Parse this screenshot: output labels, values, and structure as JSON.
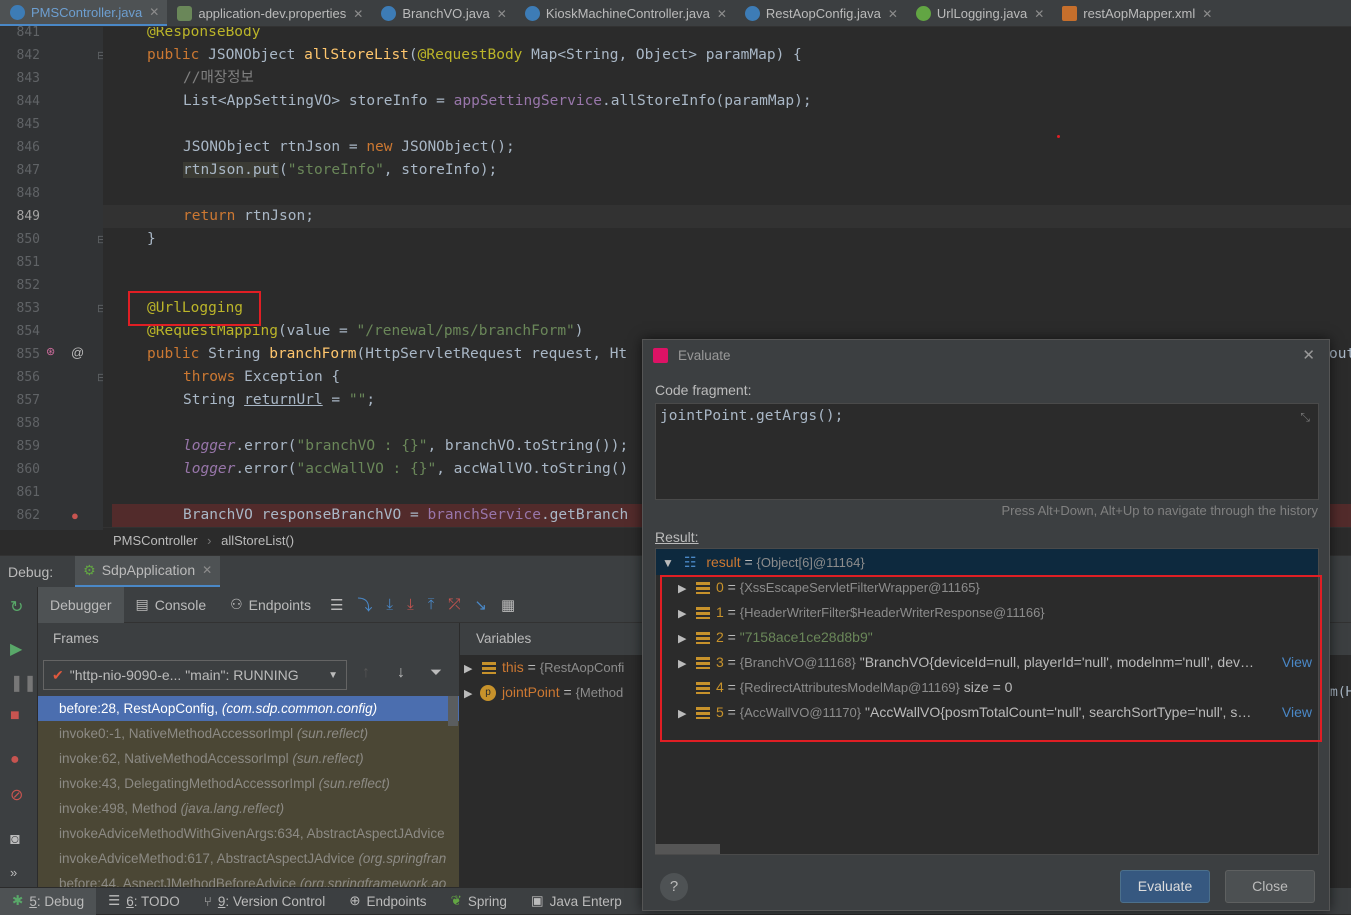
{
  "tabs": [
    {
      "label": "PMSController.java",
      "icon": "class-icon",
      "active": true
    },
    {
      "label": "application-dev.properties",
      "icon": "properties-icon",
      "active": false
    },
    {
      "label": "BranchVO.java",
      "icon": "class-icon",
      "active": false
    },
    {
      "label": "KioskMachineController.java",
      "icon": "class-icon",
      "active": false
    },
    {
      "label": "RestAopConfig.java",
      "icon": "class-icon",
      "active": false
    },
    {
      "label": "UrlLogging.java",
      "icon": "annotation-icon",
      "active": false
    },
    {
      "label": "restAopMapper.xml",
      "icon": "xml-icon",
      "active": false
    }
  ],
  "editor": {
    "line_numbers": [
      "841",
      "842",
      "843",
      "844",
      "845",
      "846",
      "847",
      "848",
      "849",
      "850",
      "851",
      "852",
      "853",
      "854",
      "855",
      "856",
      "857",
      "858",
      "859",
      "860",
      "861",
      "862"
    ],
    "current_line": "849",
    "code": {
      "l841_anno": "@ResponseBody",
      "l842_a": "public ",
      "l842_b": "JSONObject ",
      "l842_c": "allStoreList",
      "l842_d": "(",
      "l842_e": "@RequestBody ",
      "l842_f": "Map<String, Object> paramMap) {",
      "l843": "//매장정보",
      "l844_a": "List<AppSettingVO> storeInfo = ",
      "l844_b": "appSettingService",
      "l844_c": ".allStoreInfo(paramMap);",
      "l846_a": "JSONObject rtnJson = ",
      "l846_b": "new ",
      "l846_c": "JSONObject();",
      "l847_a": "rtnJson.put",
      "l847_b": "(",
      "l847_c": "\"storeInfo\"",
      "l847_d": ", storeInfo);",
      "l849_a": "return ",
      "l849_b": "rtnJson;",
      "l850": "}",
      "l853": "@UrlLogging",
      "l854_a": "@RequestMapping",
      "l854_b": "(value = ",
      "l854_c": "\"/renewal/pms/branchForm\"",
      "l854_d": ")",
      "l855_a": "public ",
      "l855_b": "String ",
      "l855_c": "branchForm",
      "l855_d": "(HttpServletRequest request, Ht",
      "l855_tail": "out",
      "l856_a": "throws ",
      "l856_b": "Exception {",
      "l857_a": "String ",
      "l857_b": "returnUrl",
      "l857_c": " = ",
      "l857_d": "\"\"",
      "l857_e": ";",
      "l859_a": "logger",
      "l859_b": ".error(",
      "l859_c": "\"branchVO : {}\"",
      "l859_d": ", branchVO.toString());",
      "l860_a": "logger",
      "l860_b": ".error(",
      "l860_c": "\"accWallVO : {}\"",
      "l860_d": ", accWallVO.toString()",
      "l860_tail": "m(H",
      "l862_a": "BranchVO responseBranchVO = ",
      "l862_b": "branchService",
      "l862_c": ".getBranch"
    }
  },
  "breadcrumb": {
    "class": "PMSController",
    "method": "allStoreList()"
  },
  "debug": {
    "label": "Debug:",
    "session": "SdpApplication",
    "tabs": [
      "Debugger",
      "Console",
      "Endpoints"
    ],
    "frames_header": "Frames",
    "variables_header": "Variables",
    "thread": "\"http-nio-9090-e... \"main\": RUNNING",
    "frames": [
      {
        "loc": "before:28, RestAopConfig",
        "pkg": "(com.sdp.common.config)",
        "selected": true
      },
      {
        "loc": "invoke0:-1, NativeMethodAccessorImpl",
        "pkg": "(sun.reflect)",
        "selected": false
      },
      {
        "loc": "invoke:62, NativeMethodAccessorImpl",
        "pkg": "(sun.reflect)",
        "selected": false
      },
      {
        "loc": "invoke:43, DelegatingMethodAccessorImpl",
        "pkg": "(sun.reflect)",
        "selected": false
      },
      {
        "loc": "invoke:498, Method",
        "pkg": "(java.lang.reflect)",
        "selected": false
      },
      {
        "loc": "invokeAdviceMethodWithGivenArgs:634, AbstractAspectJAdvice",
        "pkg": "",
        "selected": false
      },
      {
        "loc": "invokeAdviceMethod:617, AbstractAspectJAdvice",
        "pkg": "(org.springfran",
        "selected": false
      },
      {
        "loc": "before:44, AspectJMethodBeforeAdvice",
        "pkg": "(org.springframework.ao",
        "selected": false
      }
    ],
    "variables": [
      {
        "name": "this",
        "eq": " = ",
        "value": "{RestAopConfi",
        "icon": "field-icon"
      },
      {
        "name": "jointPoint",
        "eq": " = ",
        "value": "{Method",
        "icon": "parameter-icon"
      }
    ]
  },
  "statusbar": [
    {
      "num": "5",
      "label": ": Debug",
      "active": true
    },
    {
      "num": "6",
      "label": ": TODO",
      "active": false
    },
    {
      "num": "9",
      "label": ": Version Control",
      "active": false
    },
    {
      "num": "",
      "label": "Endpoints",
      "active": false
    },
    {
      "num": "",
      "label": "Spring",
      "active": false
    },
    {
      "num": "",
      "label": "Java Enterp",
      "active": false
    }
  ],
  "evaluate": {
    "title": "Evaluate",
    "code_label": "Code fragment:",
    "code": "jointPoint.getArgs();",
    "hint": "Press Alt+Down, Alt+Up to navigate through the history",
    "result_label": "Result:",
    "result": {
      "name": "result",
      "eq": " = ",
      "value": "{Object[6]@11164}"
    },
    "items": [
      {
        "idx": "0",
        "ref": "{XssEscapeServletFilterWrapper@11165}",
        "text": "",
        "expandable": true,
        "view": ""
      },
      {
        "idx": "1",
        "ref": "{HeaderWriterFilter$HeaderWriterResponse@11166}",
        "text": "",
        "expandable": true,
        "view": ""
      },
      {
        "idx": "2",
        "ref": "\"7158ace1ce28d8b9\"",
        "text": "",
        "expandable": true,
        "view": ""
      },
      {
        "idx": "3",
        "ref": "{BranchVO@11168}",
        "text": " \"BranchVO{deviceId=null, playerId='null', modelnm='null', dev…",
        "expandable": true,
        "view": "View"
      },
      {
        "idx": "4",
        "ref": "{RedirectAttributesModelMap@11169}",
        "text": "  size = 0",
        "expandable": false,
        "view": ""
      },
      {
        "idx": "5",
        "ref": "{AccWallVO@11170}",
        "text": " \"AccWallVO{posmTotalCount='null', searchSortType='null', s…",
        "expandable": true,
        "view": "View"
      }
    ],
    "evaluate_button": "Evaluate",
    "close_button": "Close",
    "help": "?"
  }
}
